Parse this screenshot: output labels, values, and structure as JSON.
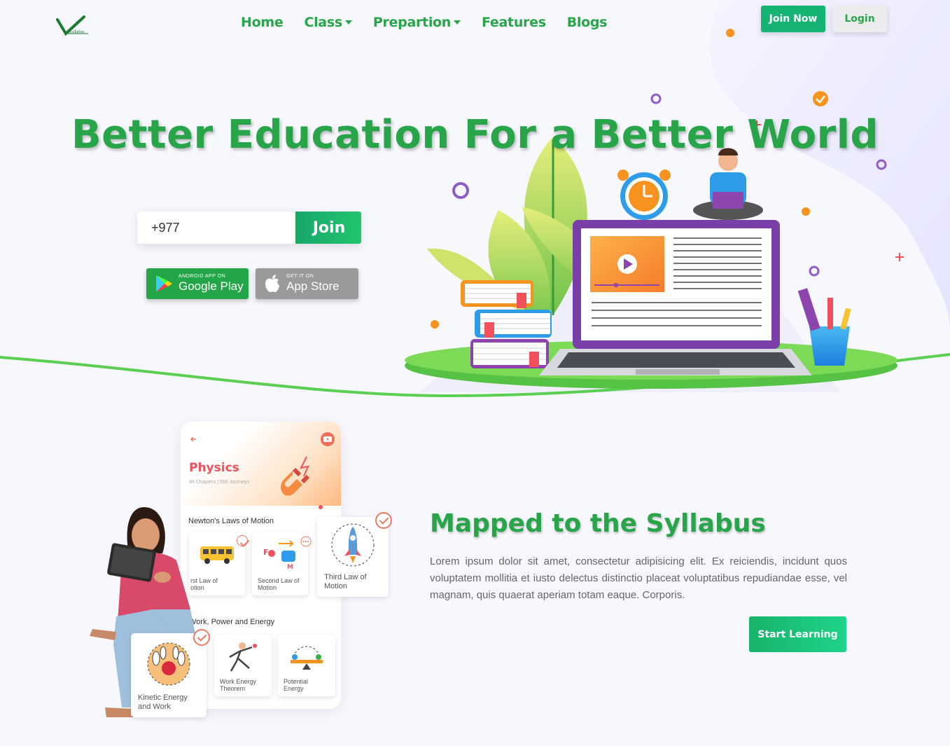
{
  "brand": {
    "logo_text": "eesillabus"
  },
  "nav": {
    "items": [
      {
        "label": "Home",
        "has_dropdown": false
      },
      {
        "label": "Class",
        "has_dropdown": true
      },
      {
        "label": "Prepartion",
        "has_dropdown": true
      },
      {
        "label": "Features",
        "has_dropdown": false
      },
      {
        "label": "Blogs",
        "has_dropdown": false
      }
    ],
    "join_now_label": "Join Now",
    "login_label": "Login"
  },
  "hero": {
    "title": "Better Education For a Better World",
    "phone_prefix": "+977",
    "phone_value": "",
    "join_label": "Join",
    "google_play": {
      "small": "ANDROID APP ON",
      "big": "Google Play",
      "icon": "play-store-icon"
    },
    "app_store": {
      "small": "GET IT ON",
      "big": "App Store",
      "icon": "apple-icon"
    }
  },
  "syllabus": {
    "title": "Mapped to the Syllabus",
    "text": "Lorem ipsum dolor sit amet, consectetur adipisicing elit. Ex reiciendis, incidunt quos voluptatem mollitia et iusto delectus distinctio placeat voluptatibus repudiandae esse, vel magnam, quis quaerat aperiam totam eaque. Corporis.",
    "cta_label": "Start Learning"
  },
  "app_preview": {
    "subject": "Physics",
    "subject_meta": "48 Chapters | 556 Journeys",
    "section1": "Newton's Laws of Motion",
    "section1_cards": [
      "rst Law of\notion",
      "Second Law of\nMotion",
      "Third Law of\nMotion"
    ],
    "section2": "Work, Power and Energy",
    "section2_cards": [
      "Kinetic Energy\nand Work",
      "Work Energy\nTheorem",
      "Potential\nEnergy"
    ],
    "mass_label": "M",
    "force_label": "F"
  },
  "colors": {
    "brand_green": "#27a548",
    "join_green": "#16b473",
    "accent_orange": "#f7931e",
    "accent_purple": "#8e44ad"
  }
}
